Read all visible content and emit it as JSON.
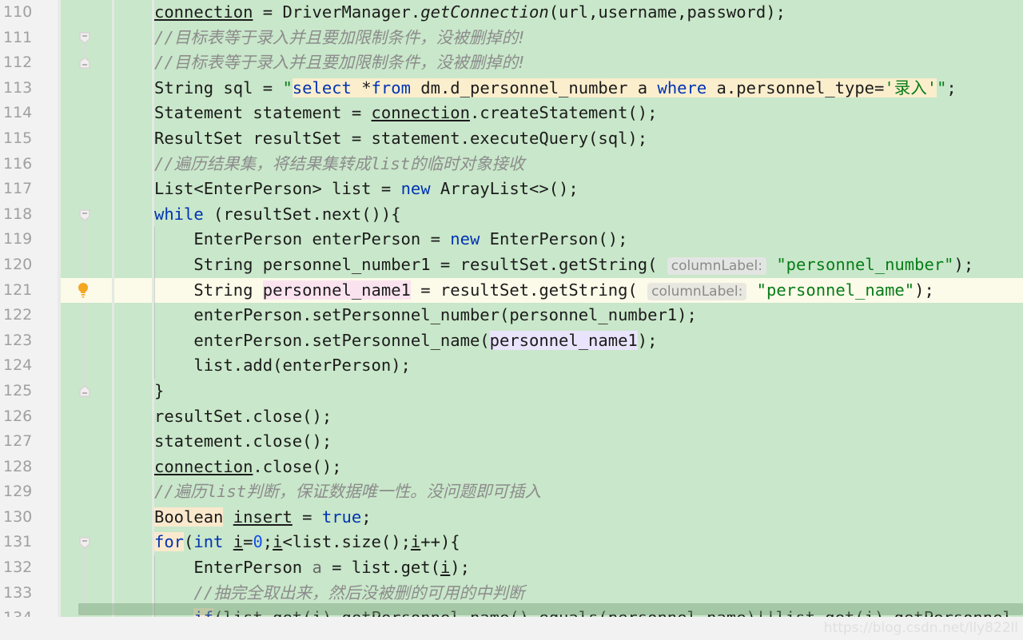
{
  "editor": {
    "language": "java",
    "colors": {
      "background": "#c9e7ca",
      "current_line": "#fcfae9",
      "gutter": "#f2f2f2",
      "line_number": "#a0a0a0",
      "keyword": "#0033b3",
      "string": "#067d17",
      "comment": "#8c8c8c",
      "number": "#1750eb",
      "sql_injection_highlight": "#faeecd",
      "usage_highlight": "#fbe9cd",
      "write_usage_highlight": "#fae3ef",
      "read_usage_highlight": "#e9e4fb",
      "scrollbar": "#8fbb8f"
    },
    "current_line_number": "121",
    "intention_bulb": "lightbulb-icon",
    "lines": [
      {
        "number": "110",
        "gutter": "",
        "text": "        connection = DriverManager.getConnection(url,username,password);"
      },
      {
        "number": "111",
        "gutter": "fold-start",
        "text": "        //目标表等于录入并且要加限制条件，没被删掉的!"
      },
      {
        "number": "112",
        "gutter": "fold-end",
        "text": "        //目标表等于录入并且要加限制条件，没被删掉的!"
      },
      {
        "number": "113",
        "gutter": "",
        "text": "        String sql = \"select *from dm.d_personnel_number a where a.personnel_type='录入'\";"
      },
      {
        "number": "114",
        "gutter": "",
        "text": "        Statement statement = connection.createStatement();"
      },
      {
        "number": "115",
        "gutter": "",
        "text": "        ResultSet resultSet = statement.executeQuery(sql);"
      },
      {
        "number": "116",
        "gutter": "",
        "text": "        //遍历结果集，将结果集转成list的临时对象接收"
      },
      {
        "number": "117",
        "gutter": "",
        "text": "        List<EnterPerson> list = new ArrayList<>();"
      },
      {
        "number": "118",
        "gutter": "fold-start",
        "text": "        while (resultSet.next()){"
      },
      {
        "number": "119",
        "gutter": "",
        "text": "            EnterPerson enterPerson = new EnterPerson();"
      },
      {
        "number": "120",
        "gutter": "",
        "text": "            String personnel_number1 = resultSet.getString( columnLabel: \"personnel_number\");"
      },
      {
        "number": "121",
        "gutter": "bulb",
        "text": "            String personnel_name1 = resultSet.getString( columnLabel: \"personnel_name\");"
      },
      {
        "number": "122",
        "gutter": "",
        "text": "            enterPerson.setPersonnel_number(personnel_number1);"
      },
      {
        "number": "123",
        "gutter": "",
        "text": "            enterPerson.setPersonnel_name(personnel_name1);"
      },
      {
        "number": "124",
        "gutter": "",
        "text": "            list.add(enterPerson);"
      },
      {
        "number": "125",
        "gutter": "fold-end",
        "text": "        }"
      },
      {
        "number": "126",
        "gutter": "",
        "text": "        resultSet.close();"
      },
      {
        "number": "127",
        "gutter": "",
        "text": "        statement.close();"
      },
      {
        "number": "128",
        "gutter": "",
        "text": "        connection.close();"
      },
      {
        "number": "129",
        "gutter": "",
        "text": "        //遍历list判断，保证数据唯一性。没问题即可插入"
      },
      {
        "number": "130",
        "gutter": "",
        "text": "        Boolean insert = true;"
      },
      {
        "number": "131",
        "gutter": "fold-start",
        "text": "        for(int i=0;i<list.size();i++){"
      },
      {
        "number": "132",
        "gutter": "",
        "text": "            EnterPerson a = list.get(i);"
      },
      {
        "number": "133",
        "gutter": "",
        "text": "            //抽完全取出来，然后没被删的可用的中判断"
      },
      {
        "number": "134",
        "gutter": "",
        "text": "            if(list.get(i).getPersonnel_name().equals(personnel_name)||list.get(i).getPersonnel_n"
      }
    ]
  },
  "watermark": {
    "text": "https://blog.csdn.net/lly822ll"
  },
  "scrollbar": {
    "name": "horizontal-scrollbar",
    "orientation": "horizontal"
  }
}
